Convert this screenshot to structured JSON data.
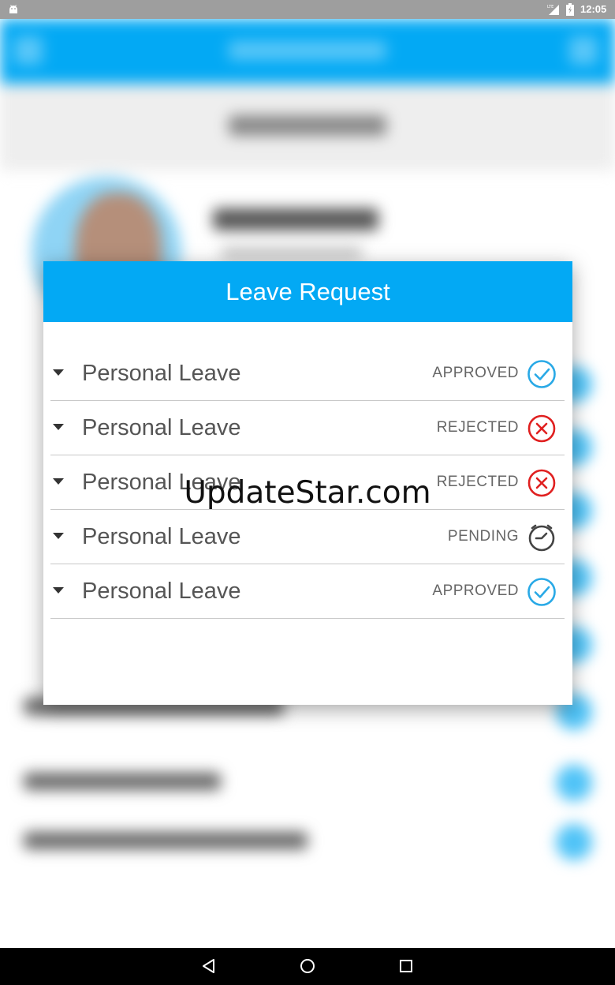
{
  "status_bar": {
    "time": "12:05",
    "icons": [
      "android-icon",
      "lte-signal-icon",
      "battery-icon"
    ]
  },
  "dialog": {
    "title": "Leave Request",
    "requests": [
      {
        "type": "Personal Leave",
        "status": "APPROVED",
        "icon": "check-circle-icon",
        "color": "#29a9e6"
      },
      {
        "type": "Personal Leave",
        "status": "REJECTED",
        "icon": "cancel-circle-icon",
        "color": "#e02020"
      },
      {
        "type": "Personal Leave",
        "status": "REJECTED",
        "icon": "cancel-circle-icon",
        "color": "#e02020"
      },
      {
        "type": "Personal Leave",
        "status": "PENDING",
        "icon": "clock-icon",
        "color": "#444444"
      },
      {
        "type": "Personal Leave",
        "status": "APPROVED",
        "icon": "check-circle-icon",
        "color": "#29a9e6"
      }
    ]
  },
  "watermark": "UpdateStar.com",
  "nav_bar": {
    "icons": [
      "back-icon",
      "home-icon",
      "recents-icon"
    ]
  },
  "colors": {
    "accent": "#03a9f4",
    "approved": "#29a9e6",
    "rejected": "#e02020",
    "pending": "#444444"
  }
}
